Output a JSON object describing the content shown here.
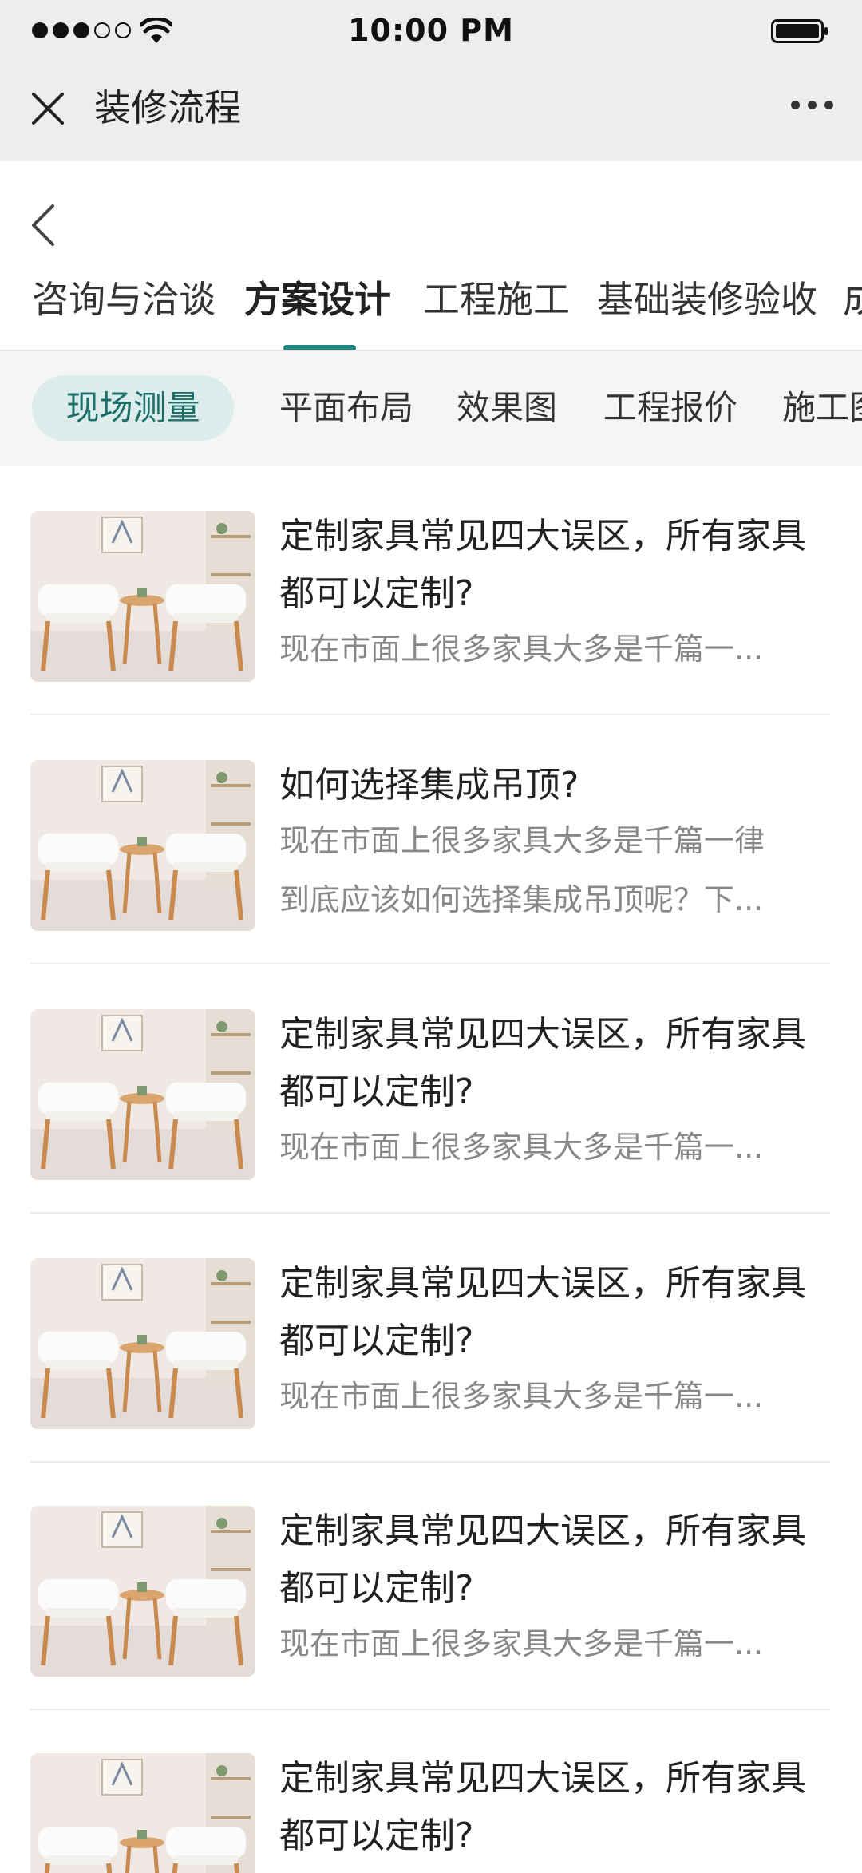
{
  "status_bar": {
    "time": "10:00 PM"
  },
  "nav": {
    "title": "装修流程"
  },
  "tabs": [
    {
      "label": "咨询与洽谈",
      "active": false
    },
    {
      "label": "方案设计",
      "active": true
    },
    {
      "label": "工程施工",
      "active": false
    },
    {
      "label": "基础装修验收",
      "active": false
    },
    {
      "label": "成",
      "active": false
    }
  ],
  "subtabs": [
    {
      "label": "现场测量",
      "active": true
    },
    {
      "label": "平面布局",
      "active": false
    },
    {
      "label": "效果图",
      "active": false
    },
    {
      "label": "工程报价",
      "active": false
    },
    {
      "label": "施工图",
      "active": false
    }
  ],
  "articles": [
    {
      "title_line1": "定制家具常见四大误区，所有家具",
      "title_line2": "都可以定制?",
      "desc_line1": "现在市面上很多家具大多是千篇一...",
      "desc_line2": ""
    },
    {
      "title_line1": "如何选择集成吊顶?",
      "title_line2": "",
      "desc_line1": "现在市面上很多家具大多是千篇一律",
      "desc_line2": "到底应该如何选择集成吊顶呢？下..."
    },
    {
      "title_line1": "定制家具常见四大误区，所有家具",
      "title_line2": "都可以定制?",
      "desc_line1": "现在市面上很多家具大多是千篇一...",
      "desc_line2": ""
    },
    {
      "title_line1": "定制家具常见四大误区，所有家具",
      "title_line2": "都可以定制?",
      "desc_line1": "现在市面上很多家具大多是千篇一...",
      "desc_line2": ""
    },
    {
      "title_line1": "定制家具常见四大误区，所有家具",
      "title_line2": "都可以定制?",
      "desc_line1": "现在市面上很多家具大多是千篇一...",
      "desc_line2": ""
    },
    {
      "title_line1": "定制家具常见四大误区，所有家具",
      "title_line2": "都可以定制?",
      "desc_line1": "",
      "desc_line2": ""
    }
  ],
  "colors": {
    "accent": "#1e8a82",
    "chip_bg": "#dbecea",
    "chip_text": "#1c6f6a",
    "nav_bg": "#ededed"
  }
}
